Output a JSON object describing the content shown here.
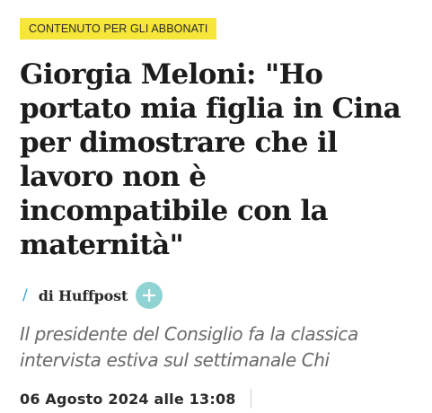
{
  "article": {
    "badge": "CONTENUTO PER GLI ABBONATI",
    "headline": "Giorgia Meloni: \"Ho portato mia figlia in Cina per dimostrare che il lavoro non è incompatibile con la maternità\"",
    "byline": {
      "separator": "/",
      "author": "di Huffpost",
      "follow_icon": "plus-icon"
    },
    "subtitle": "Il presidente del Consiglio fa la classica intervista estiva sul settimanale Chi",
    "date": "06 Agosto 2024 alle 13:08"
  },
  "colors": {
    "badge_bg": "#f6e63a",
    "accent": "#3aa6c9",
    "follow_bg": "#8fd3d3",
    "subtitle_text": "#6a6a6a"
  }
}
